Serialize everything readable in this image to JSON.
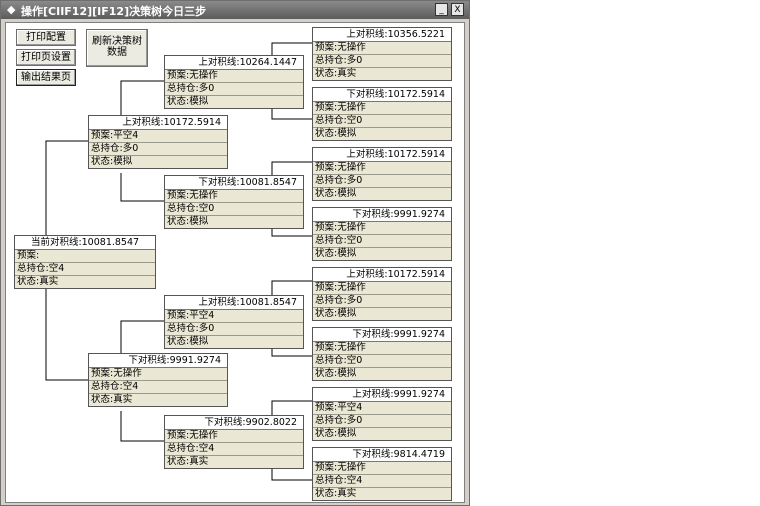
{
  "window": {
    "title_icon": "◆",
    "title": "操作[CIIF12][IF12]决策树今日三步",
    "minimize": "_",
    "close": "X"
  },
  "toolbar": {
    "print_config": "打印配置",
    "page_setup": "打印页设置",
    "export": "输出结果页",
    "refresh_line1": "刷新决策树",
    "refresh_line2": "数据"
  },
  "labels": {
    "plan": "预案:",
    "pos": "总持仓:",
    "state": "状态:"
  },
  "nodes": {
    "root": {
      "title": "当前对积线:10081.8547",
      "plan": "",
      "pos": "空4",
      "state": "真实"
    },
    "u": {
      "title": "上对积线:10172.5914",
      "plan": "平空4",
      "pos": "多0",
      "state": "模拟"
    },
    "d": {
      "title": "下对积线:9991.9274",
      "plan": "无操作",
      "pos": "空4",
      "state": "真实"
    },
    "uu": {
      "title": "上对积线:10264.1447",
      "plan": "无操作",
      "pos": "多0",
      "state": "模拟"
    },
    "ud": {
      "title": "下对积线:10081.8547",
      "plan": "无操作",
      "pos": "空0",
      "state": "模拟"
    },
    "du": {
      "title": "上对积线:10081.8547",
      "plan": "平空4",
      "pos": "多0",
      "state": "模拟"
    },
    "dd": {
      "title": "下对积线:9902.8022",
      "plan": "无操作",
      "pos": "空4",
      "state": "真实"
    },
    "uuu": {
      "title": "上对积线:10356.5221",
      "plan": "无操作",
      "pos": "多0",
      "state": "真实"
    },
    "uud": {
      "title": "下对积线:10172.5914",
      "plan": "无操作",
      "pos": "空0",
      "state": "模拟"
    },
    "udu": {
      "title": "上对积线:10172.5914",
      "plan": "无操作",
      "pos": "多0",
      "state": "模拟"
    },
    "udd": {
      "title": "下对积线:9991.9274",
      "plan": "无操作",
      "pos": "空0",
      "state": "模拟"
    },
    "duu": {
      "title": "上对积线:10172.5914",
      "plan": "无操作",
      "pos": "多0",
      "state": "模拟"
    },
    "dud": {
      "title": "下对积线:9991.9274",
      "plan": "无操作",
      "pos": "空0",
      "state": "模拟"
    },
    "ddu": {
      "title": "上对积线:9991.9274",
      "plan": "平空4",
      "pos": "多0",
      "state": "模拟"
    },
    "ddd": {
      "title": "下对积线:9814.4719",
      "plan": "无操作",
      "pos": "空4",
      "state": "真实"
    }
  }
}
